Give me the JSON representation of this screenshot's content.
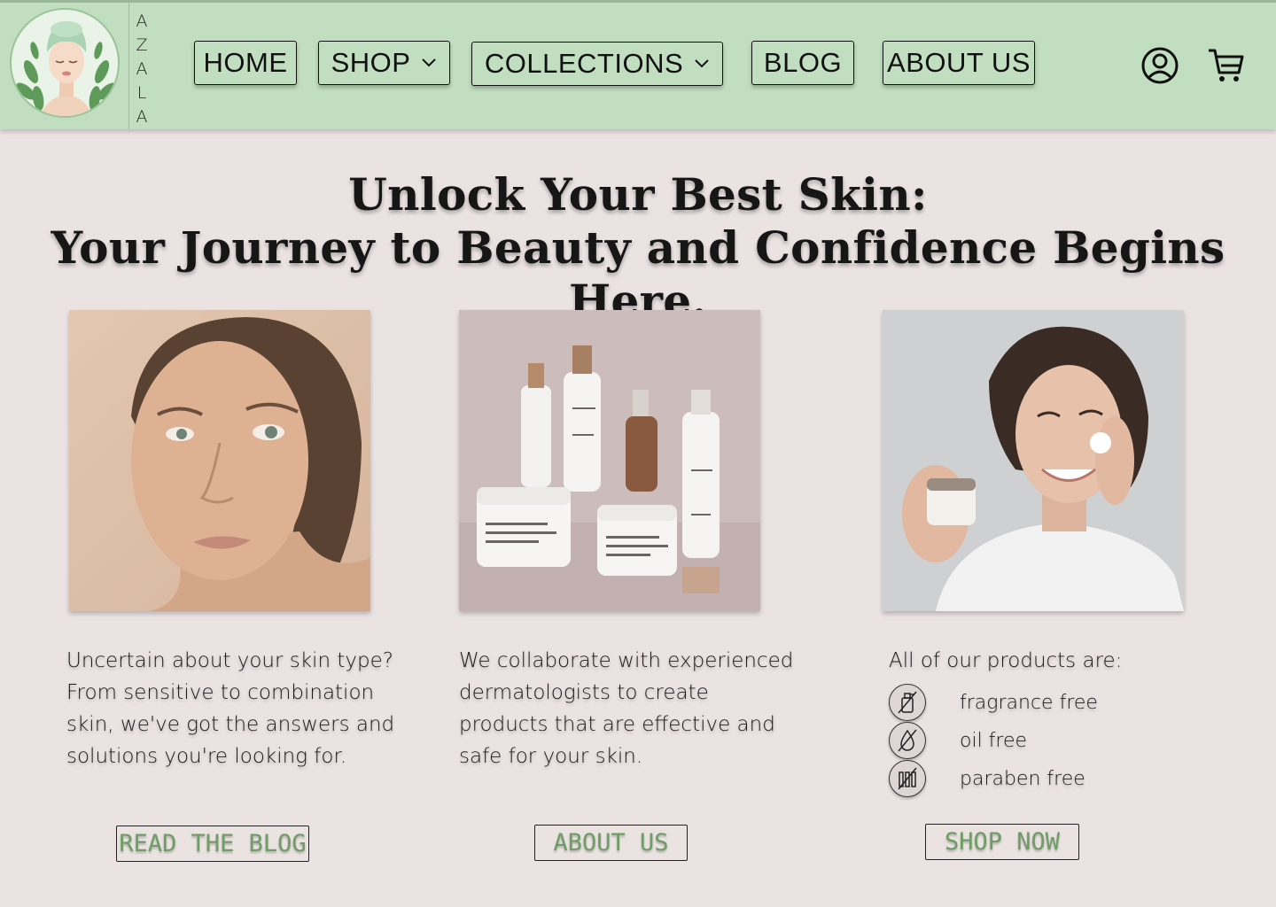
{
  "brand": {
    "letters": [
      "A",
      "Z",
      "A",
      "L",
      "A"
    ],
    "accent_color": "#c2dec0",
    "logo_icon": "woman-face-logo-icon"
  },
  "nav": {
    "home": "HOME",
    "shop": "SHOP",
    "collections": "COLLECTIONS",
    "blog": "BLOG",
    "about": "ABOUT US",
    "account_icon": "user-account-icon",
    "cart_icon": "shopping-cart-icon"
  },
  "hero": {
    "line1": "Unlock Your Best Skin:",
    "line2": "Your Journey to Beauty and Confidence Begins Here."
  },
  "cards": {
    "blog": {
      "image": "woman-portrait-photo",
      "text": "Uncertain about your skin type? From sensitive to combination skin, we've got the answers and solutions you're looking for.",
      "cta": "READ THE BLOG"
    },
    "about": {
      "image": "skincare-products-photo",
      "text": "We collaborate with experienced dermatologists to create products that are effective and safe for your skin.",
      "cta": "ABOUT US"
    },
    "shop": {
      "image": "woman-applying-cream-photo",
      "intro": "All of our products are:",
      "features": [
        {
          "label": "fragrance free",
          "icon": "no-fragrance-icon"
        },
        {
          "label": "oil free",
          "icon": "no-oil-icon"
        },
        {
          "label": "paraben free",
          "icon": "no-paraben-icon"
        }
      ],
      "cta": "SHOP NOW"
    }
  },
  "colors": {
    "background": "#ebe3e2",
    "cta_text": "#6e9e66"
  }
}
